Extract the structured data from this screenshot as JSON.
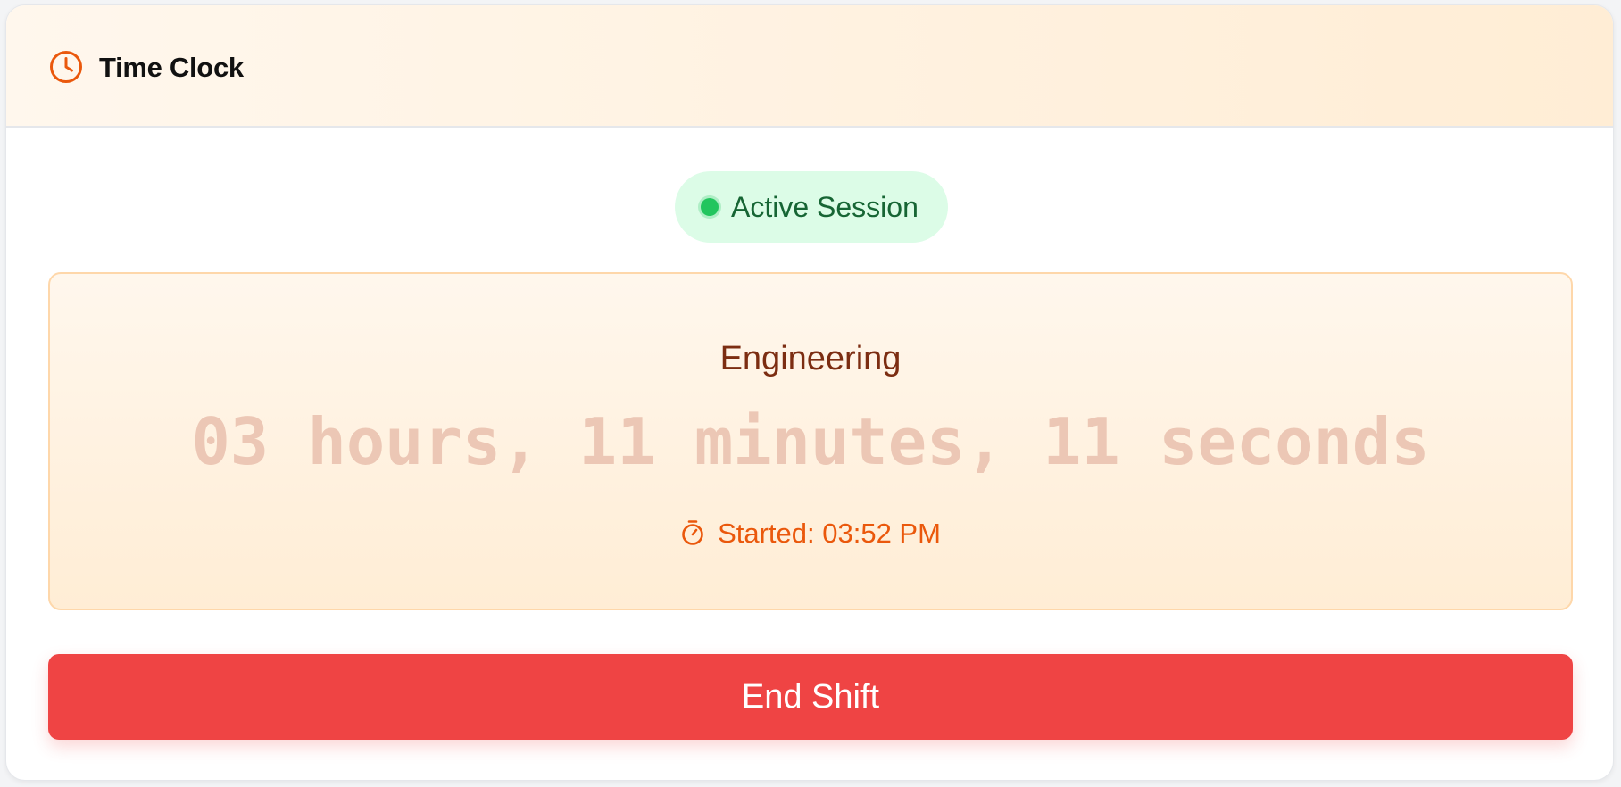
{
  "header": {
    "icon": "clock-icon",
    "title": "Time Clock",
    "accent_color": "#ea580c"
  },
  "status": {
    "label": "Active Session",
    "indicator_color": "#22c55e"
  },
  "session": {
    "department": "Engineering",
    "elapsed": "03 hours, 11 minutes, 11 seconds",
    "started_icon": "stopwatch-icon",
    "started_text": "Started: 03:52 PM"
  },
  "actions": {
    "end_shift_label": "End Shift",
    "end_shift_color": "#ef4444"
  }
}
